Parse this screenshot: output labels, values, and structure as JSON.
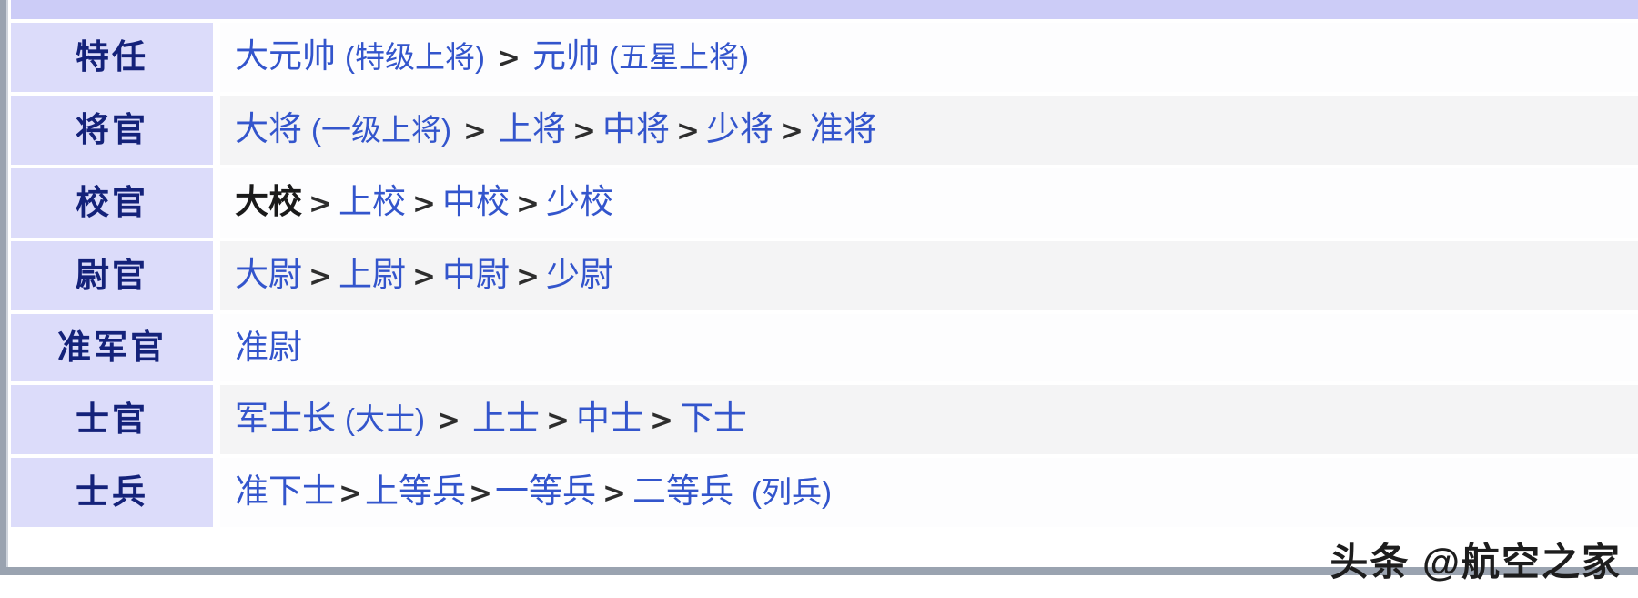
{
  "table": {
    "header_band": "",
    "rows": [
      {
        "category": "特任",
        "parts": [
          {
            "text": "大元帅",
            "style": "lnk"
          },
          {
            "text": " ",
            "style": "sp"
          },
          {
            "text": "(特级上将)",
            "style": "paren"
          },
          {
            "text": ">",
            "style": "sep-wide"
          },
          {
            "text": "元帅",
            "style": "lnk"
          },
          {
            "text": " ",
            "style": "sp"
          },
          {
            "text": "(五星上将)",
            "style": "paren"
          }
        ],
        "plain": "大元帅 (特级上将) > 元帅 (五星上将)"
      },
      {
        "category": "将官",
        "parts": [
          {
            "text": "大将",
            "style": "lnk"
          },
          {
            "text": " ",
            "style": "sp"
          },
          {
            "text": "(一级上将)",
            "style": "paren"
          },
          {
            "text": ">",
            "style": "sep-wide"
          },
          {
            "text": "上将",
            "style": "lnk"
          },
          {
            "text": ">",
            "style": "sep"
          },
          {
            "text": "中将",
            "style": "lnk"
          },
          {
            "text": ">",
            "style": "sep"
          },
          {
            "text": "少将",
            "style": "lnk"
          },
          {
            "text": ">",
            "style": "sep"
          },
          {
            "text": "准将",
            "style": "lnk"
          }
        ],
        "plain": "大将 (一级上将) > 上将 > 中将 > 少将 > 准将"
      },
      {
        "category": "校官",
        "parts": [
          {
            "text": "大校",
            "style": "bold"
          },
          {
            "text": ">",
            "style": "sep"
          },
          {
            "text": "上校",
            "style": "lnk"
          },
          {
            "text": ">",
            "style": "sep"
          },
          {
            "text": "中校",
            "style": "lnk"
          },
          {
            "text": ">",
            "style": "sep"
          },
          {
            "text": "少校",
            "style": "lnk"
          }
        ],
        "plain": "大校 > 上校 > 中校 > 少校"
      },
      {
        "category": "尉官",
        "parts": [
          {
            "text": "大尉",
            "style": "lnk"
          },
          {
            "text": ">",
            "style": "sep"
          },
          {
            "text": "上尉",
            "style": "lnk"
          },
          {
            "text": ">",
            "style": "sep"
          },
          {
            "text": "中尉",
            "style": "lnk"
          },
          {
            "text": ">",
            "style": "sep"
          },
          {
            "text": "少尉",
            "style": "lnk"
          }
        ],
        "plain": "大尉 > 上尉 > 中尉 > 少尉"
      },
      {
        "category": "准军官",
        "parts": [
          {
            "text": "准尉",
            "style": "lnk"
          }
        ],
        "plain": "准尉"
      },
      {
        "category": "士官",
        "parts": [
          {
            "text": "军士长",
            "style": "lnk"
          },
          {
            "text": " ",
            "style": "sp"
          },
          {
            "text": "(大士)",
            "style": "paren"
          },
          {
            "text": ">",
            "style": "sep-wide"
          },
          {
            "text": "上士",
            "style": "lnk"
          },
          {
            "text": ">",
            "style": "sep"
          },
          {
            "text": "中士",
            "style": "lnk"
          },
          {
            "text": ">",
            "style": "sep"
          },
          {
            "text": "下士",
            "style": "lnk"
          }
        ],
        "plain": "军士长 (大士) > 上士 > 中士 > 下士"
      },
      {
        "category": "士兵",
        "parts": [
          {
            "text": "准下士",
            "style": "lnk"
          },
          {
            "text": ">",
            "style": "sep-tight"
          },
          {
            "text": "上等兵",
            "style": "lnk"
          },
          {
            "text": ">",
            "style": "sep-tight"
          },
          {
            "text": "一等兵",
            "style": "lnk"
          },
          {
            "text": ">",
            "style": "sep"
          },
          {
            "text": "二等兵",
            "style": "lnk"
          },
          {
            "text": "  ",
            "style": "sp2"
          },
          {
            "text": "(列兵)",
            "style": "paren"
          }
        ],
        "plain": "准下士 > 上等兵 > 一等兵 > 二等兵 (列兵)"
      }
    ]
  },
  "watermark": {
    "text": "头条 @航空之家"
  },
  "colors": {
    "header_band": "#ccccf7",
    "category_cell": "#dcdcfa",
    "category_text": "#14227a",
    "link_text": "#3355cc",
    "bold_text": "#1a1a1a",
    "row_odd": "#fdfdfe",
    "row_even": "#f4f4f5",
    "frame_border": "#9aa3b0"
  }
}
